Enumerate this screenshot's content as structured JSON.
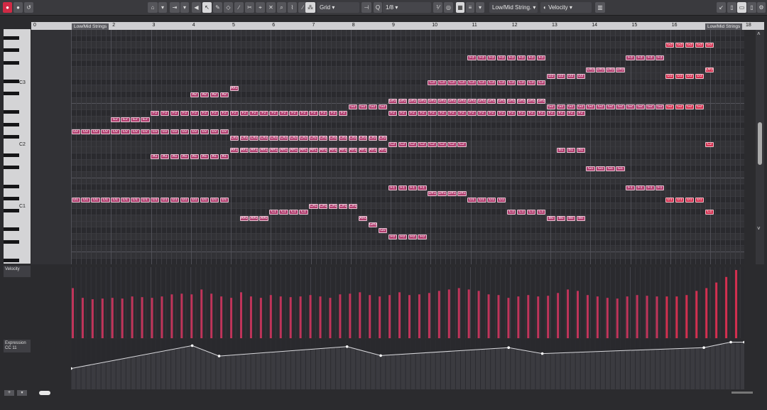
{
  "toolbar": {
    "snap_mode": "Grid",
    "quantize": "1/8",
    "track": "Low/Mid String.",
    "lane_param": "Velocity"
  },
  "ruler": {
    "start_label": "0",
    "bars": [
      "2",
      "3",
      "4",
      "5",
      "6",
      "7",
      "8",
      "9",
      "10",
      "11",
      "12",
      "13",
      "14",
      "15",
      "16"
    ],
    "end_label": "18",
    "part_name": "Low/Mid Strings"
  },
  "keyboard": {
    "labels": [
      "C3",
      "C2",
      "C1"
    ]
  },
  "lanes": {
    "velocity_label": "Velocity",
    "expression_label": "Expression",
    "expression_cc": "CC 11"
  },
  "colors": {
    "note": "#b03d6e",
    "note_hi": "#d32f4f",
    "vel": "#c0345a"
  },
  "notes": [
    {
      "pitch": "D1",
      "row": 27,
      "start": 0,
      "count": 8
    },
    {
      "pitch": "D1",
      "row": 27,
      "start": 8,
      "count": 8
    },
    {
      "pitch": "D2",
      "row": 16,
      "start": 0,
      "count": 16
    },
    {
      "pitch": "E2",
      "row": 14,
      "start": 4,
      "count": 4
    },
    {
      "pitch": "F2",
      "row": 13,
      "start": 8,
      "count": 20
    },
    {
      "pitch": "A2",
      "row": 10,
      "start": 12,
      "count": 4
    },
    {
      "pitch": "A#2",
      "row": 9,
      "start": 16,
      "count": 1
    },
    {
      "pitch": "A1",
      "row": 20,
      "start": 8,
      "count": 8
    },
    {
      "pitch": "C#2",
      "row": 17,
      "start": 16,
      "count": 16
    },
    {
      "pitch": "A#1",
      "row": 19,
      "start": 16,
      "count": 16
    },
    {
      "pitch": "A#0",
      "row": 30,
      "start": 17,
      "count": 3
    },
    {
      "pitch": "C1",
      "row": 29,
      "start": 20,
      "count": 4
    },
    {
      "pitch": "C#1",
      "row": 28,
      "start": 24,
      "count": 5
    },
    {
      "pitch": "G2",
      "row": 12,
      "start": 28,
      "count": 4
    },
    {
      "pitch": "G#2",
      "row": 11,
      "start": 32,
      "count": 16
    },
    {
      "pitch": "F2",
      "row": 13,
      "start": 32,
      "count": 16
    },
    {
      "pitch": "C2",
      "row": 18,
      "start": 32,
      "count": 8
    },
    {
      "pitch": "A#0",
      "row": 30,
      "start": 29,
      "count": 1
    },
    {
      "pitch": "G#0",
      "row": 31,
      "start": 30,
      "count": 1
    },
    {
      "pitch": "G0",
      "row": 32,
      "start": 31,
      "count": 1
    },
    {
      "pitch": "F0",
      "row": 33,
      "start": 32,
      "count": 4
    },
    {
      "pitch": "F1",
      "row": 25,
      "start": 32,
      "count": 4
    },
    {
      "pitch": "D#1",
      "row": 26,
      "start": 36,
      "count": 4
    },
    {
      "pitch": "C3",
      "row": 8,
      "start": 36,
      "count": 12
    },
    {
      "pitch": "F3",
      "row": 4,
      "start": 40,
      "count": 8
    },
    {
      "pitch": "D1",
      "row": 27,
      "start": 40,
      "count": 4
    },
    {
      "pitch": "C1",
      "row": 29,
      "start": 44,
      "count": 4
    },
    {
      "pitch": "D3",
      "row": 7,
      "start": 48,
      "count": 4
    },
    {
      "pitch": "D#3",
      "row": 6,
      "start": 52,
      "count": 4
    },
    {
      "pitch": "G2",
      "row": 12,
      "start": 48,
      "count": 16
    },
    {
      "pitch": "F2",
      "row": 13,
      "start": 48,
      "count": 4
    },
    {
      "pitch": "B1",
      "row": 19,
      "start": 49,
      "count": 3
    },
    {
      "pitch": "B0",
      "row": 30,
      "start": 48,
      "count": 4
    },
    {
      "pitch": "G1",
      "row": 22,
      "start": 52,
      "count": 4
    },
    {
      "pitch": "F1",
      "row": 25,
      "start": 56,
      "count": 4
    },
    {
      "pitch": "F3",
      "row": 4,
      "start": 56,
      "count": 4
    },
    {
      "pitch": "G3",
      "row": 2,
      "start": 60,
      "count": 5
    },
    {
      "pitch": "D3",
      "row": 7,
      "start": 60,
      "count": 4
    },
    {
      "pitch": "D#3",
      "row": 6,
      "start": 64,
      "count": 1
    },
    {
      "pitch": "D1",
      "row": 27,
      "start": 60,
      "count": 4
    },
    {
      "pitch": "C1",
      "row": 29,
      "start": 64,
      "count": 1
    },
    {
      "pitch": "C2",
      "row": 18,
      "start": 64,
      "count": 1
    }
  ],
  "velocity_values": [
    0.72,
    0.58,
    0.56,
    0.57,
    0.58,
    0.57,
    0.6,
    0.59,
    0.58,
    0.6,
    0.63,
    0.64,
    0.63,
    0.7,
    0.64,
    0.6,
    0.58,
    0.66,
    0.6,
    0.58,
    0.62,
    0.6,
    0.59,
    0.6,
    0.62,
    0.6,
    0.58,
    0.63,
    0.64,
    0.66,
    0.62,
    0.6,
    0.62,
    0.66,
    0.62,
    0.63,
    0.65,
    0.68,
    0.7,
    0.72,
    0.7,
    0.68,
    0.63,
    0.62,
    0.58,
    0.6,
    0.62,
    0.6,
    0.61,
    0.65,
    0.7,
    0.68,
    0.62,
    0.6,
    0.58,
    0.57,
    0.6,
    0.62,
    0.61,
    0.6,
    0.6,
    0.6,
    0.62,
    0.68,
    0.72,
    0.8,
    0.88,
    0.98
  ],
  "expression_points": [
    [
      0,
      0.58
    ],
    [
      0.18,
      0.12
    ],
    [
      0.22,
      0.33
    ],
    [
      0.41,
      0.14
    ],
    [
      0.46,
      0.32
    ],
    [
      0.65,
      0.16
    ],
    [
      0.7,
      0.28
    ],
    [
      0.94,
      0.16
    ],
    [
      0.98,
      0.05
    ],
    [
      1,
      0.05
    ]
  ]
}
